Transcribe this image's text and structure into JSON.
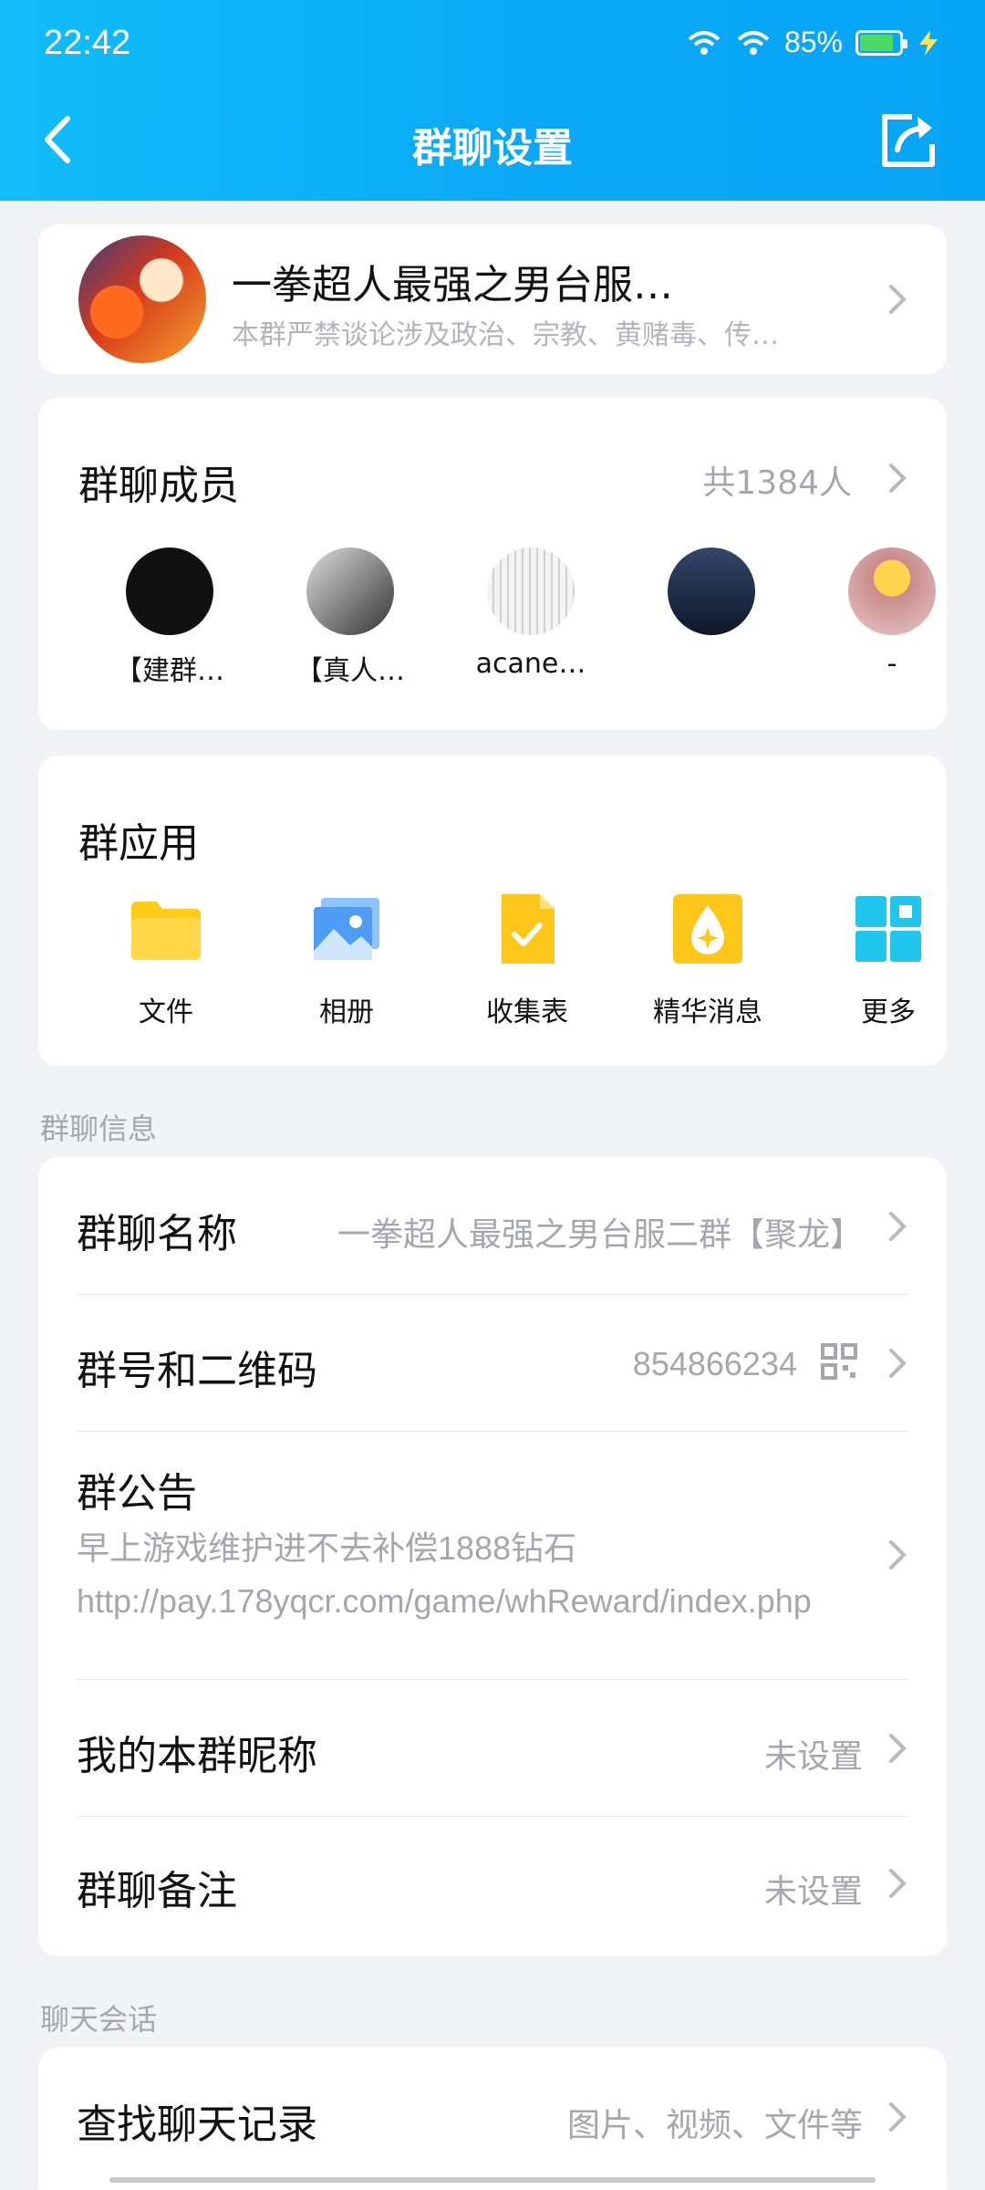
{
  "status": {
    "time": "22:42",
    "battery": "85%",
    "battery_level": 0.85
  },
  "nav": {
    "title": "群聊设置"
  },
  "group": {
    "name": "一拳超人最强之男台服…",
    "description": "本群严禁谈论涉及政治、宗教、黄赌毒、传…"
  },
  "members": {
    "title": "群聊成员",
    "count": "共1384人",
    "list": [
      {
        "name": "【建群…",
        "icon": "dog-avatar-icon",
        "color": "#111"
      },
      {
        "name": "【真人…",
        "icon": "person-avatar-icon",
        "color": "#4a4a4a"
      },
      {
        "name": "acane…",
        "icon": "sketch-avatar-icon",
        "color": "#e8e8e8"
      },
      {
        "name": "",
        "icon": "person-avatar-icon",
        "color": "#1b2a44"
      },
      {
        "name": "-",
        "icon": "cartoon-avatar-icon",
        "color": "#c9a6a6"
      }
    ]
  },
  "apps": {
    "title": "群应用",
    "items": [
      {
        "label": "文件",
        "icon": "folder-icon",
        "color": "#ffcc1a"
      },
      {
        "label": "相册",
        "icon": "photo-icon",
        "color": "#4f9cf5"
      },
      {
        "label": "收集表",
        "icon": "form-check-icon",
        "color": "#ffc61a"
      },
      {
        "label": "精华消息",
        "icon": "essence-drop-icon",
        "color": "#ffc61a"
      },
      {
        "label": "更多",
        "icon": "grid-more-icon",
        "color": "#22c6ec"
      }
    ]
  },
  "info": {
    "section_label": "群聊信息",
    "name_title": "群聊名称",
    "name_value": "一拳超人最强之男台服二群【聚龙】",
    "id_title": "群号和二维码",
    "id_value": "854866234",
    "notice_title": "群公告",
    "notice_text": "早上游戏维护进不去补偿1888钻石 http://pay.178yqcr.com/game/whReward/index.php",
    "nickname_title": "我的本群昵称",
    "nickname_value": "未设置",
    "remark_title": "群聊备注",
    "remark_value": "未设置"
  },
  "chat": {
    "section_label": "聊天会话",
    "search_title": "查找聊天记录",
    "search_value": "图片、视频、文件等"
  }
}
